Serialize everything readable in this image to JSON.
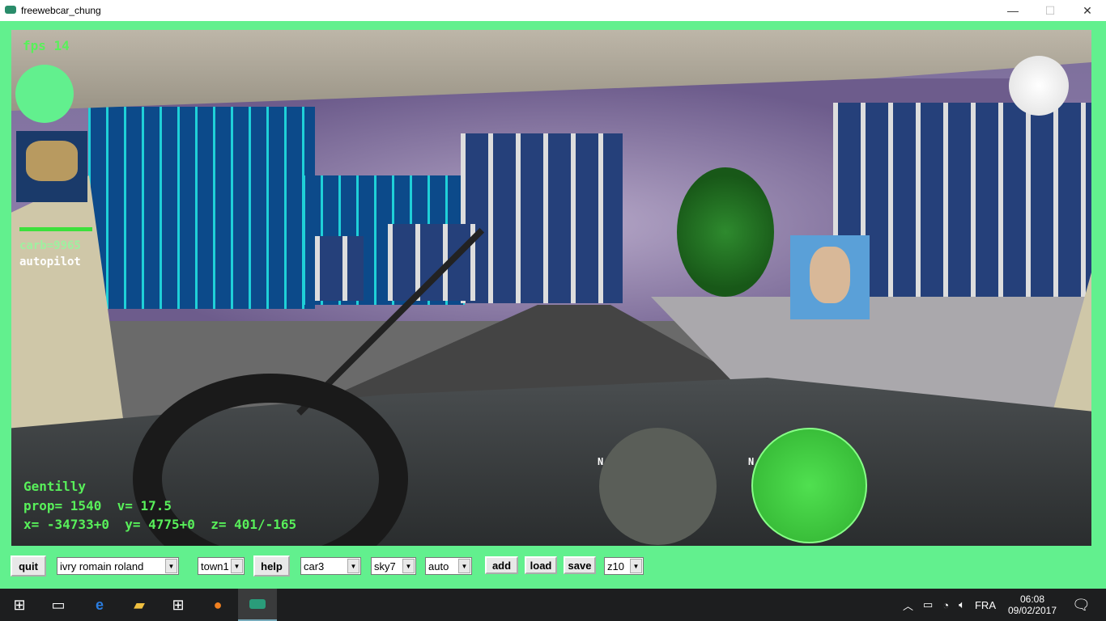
{
  "window": {
    "title": "freewebcar_chung",
    "minimize": "—",
    "maximize": "☐",
    "close": "✕"
  },
  "hud": {
    "fps": "fps 14",
    "carb": "carb=9965",
    "mode": "autopilot",
    "place": "Gentilly",
    "prop_line": "prop= 1540  v= 17.5",
    "coords": "x= -34733+0  y= 4775+0  z= 401/-165",
    "north_label": "N",
    "fuel_level": 1.0
  },
  "toolbar": {
    "quit": "quit",
    "location": "ivry romain roland",
    "town": "town1",
    "help": "help",
    "car": "car3",
    "sky": "sky7",
    "mode": "auto",
    "add": "add",
    "load": "load",
    "save": "save",
    "zoom": "z10"
  },
  "taskbar": {
    "icons": [
      "windows-start",
      "task-view",
      "edge",
      "file-explorer",
      "store",
      "firefox",
      "freewebcar"
    ],
    "lang": "FRA",
    "time": "06:08",
    "date": "09/02/2017"
  },
  "colors": {
    "frame": "#62f08e",
    "hud_text": "#58f05a"
  }
}
